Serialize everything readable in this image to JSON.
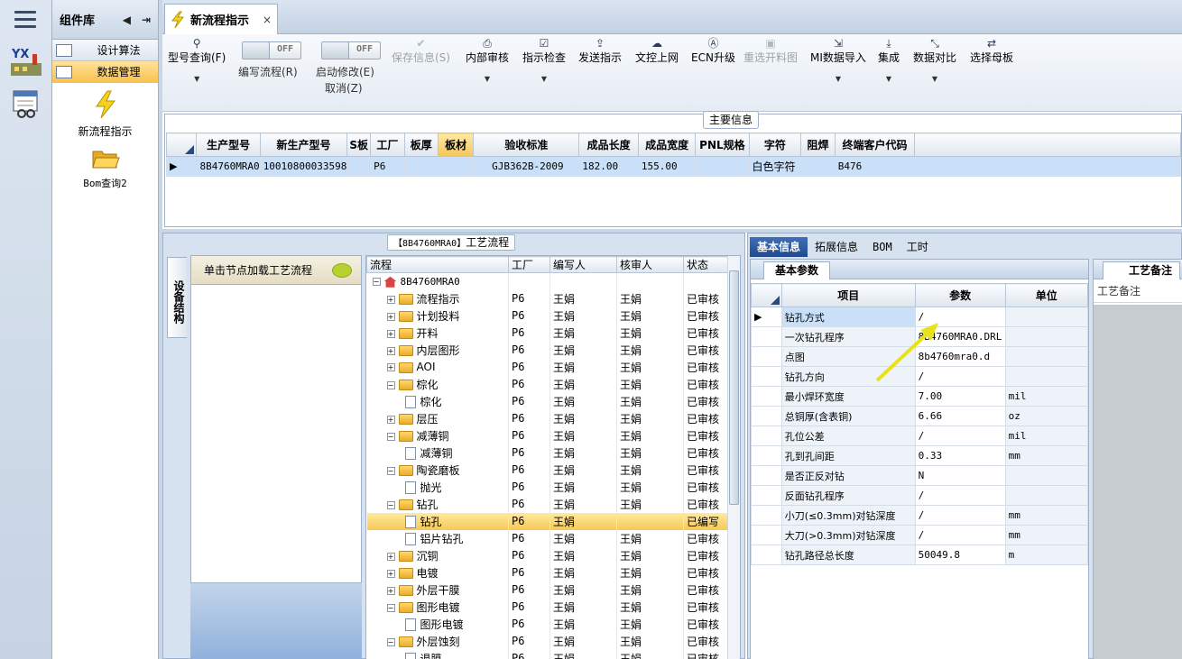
{
  "rail": {
    "logo_text": "YX"
  },
  "library": {
    "title": "组件库",
    "items": [
      {
        "label": "设计算法",
        "active": false
      },
      {
        "label": "数据管理",
        "active": true
      }
    ],
    "big": [
      {
        "label": "新流程指示"
      },
      {
        "label": "Bom查询2"
      }
    ]
  },
  "tab": {
    "title": "新流程指示",
    "close": "×"
  },
  "toolbar": {
    "model_query": "型号查询(F)",
    "edit_flow": "编写流程(R)",
    "edit_flow_toggle": "OFF",
    "start_modify": "启动修改(E)",
    "cancel": "取消(Z)",
    "start_modify_toggle": "OFF",
    "save_info": "保存信息(S)",
    "internal_review": "内部审核",
    "instruction_check": "指示检查",
    "send_instruction": "发送指示",
    "doc_control_online": "文控上网",
    "ecn_upgrade": "ECN升级",
    "reselect_panel_map": "重选开料图",
    "mi_data_import": "MI数据导入",
    "integrate": "集成",
    "data_compare": "数据对比",
    "select_mother_board": "选择母板"
  },
  "main_info": {
    "caption": "主要信息",
    "columns": [
      "生产型号",
      "新生产型号",
      "S板",
      "工厂",
      "板厚",
      "板材",
      "验收标准",
      "成品长度",
      "成品宽度",
      "PNL规格",
      "字符",
      "阻焊",
      "终端客户代码"
    ],
    "rows": [
      [
        "8B4760MRA0",
        "10010800033598",
        "",
        "P6",
        "",
        "",
        "GJB362B-2009",
        "182.00",
        "155.00",
        "",
        "白色字符",
        "",
        "B476"
      ]
    ]
  },
  "process": {
    "caption_code": "【8B4760MRA0】",
    "caption_text": "工艺流程",
    "side_tab": "设备结构",
    "hint": "单击节点加载工艺流程",
    "columns": [
      "流程",
      "工厂",
      "编写人",
      "核审人",
      "状态"
    ],
    "root": "8B4760MRA0",
    "rows": [
      {
        "name": "流程指示",
        "type": "folder",
        "expand": "+",
        "level": 1,
        "factory": "P6",
        "writer": "王娟",
        "reviewer": "王娟",
        "status": "已审核"
      },
      {
        "name": "计划投料",
        "type": "folder",
        "expand": "+",
        "level": 1,
        "factory": "P6",
        "writer": "王娟",
        "reviewer": "王娟",
        "status": "已审核"
      },
      {
        "name": "开料",
        "type": "folder",
        "expand": "+",
        "level": 1,
        "factory": "P6",
        "writer": "王娟",
        "reviewer": "王娟",
        "status": "已审核"
      },
      {
        "name": "内层图形",
        "type": "folder",
        "expand": "+",
        "level": 1,
        "factory": "P6",
        "writer": "王娟",
        "reviewer": "王娟",
        "status": "已审核"
      },
      {
        "name": "AOI",
        "type": "folder",
        "expand": "+",
        "level": 1,
        "factory": "P6",
        "writer": "王娟",
        "reviewer": "王娟",
        "status": "已审核"
      },
      {
        "name": "棕化",
        "type": "folder",
        "expand": "-",
        "level": 1,
        "factory": "P6",
        "writer": "王娟",
        "reviewer": "王娟",
        "status": "已审核"
      },
      {
        "name": "棕化",
        "type": "doc",
        "expand": "",
        "level": 2,
        "factory": "P6",
        "writer": "王娟",
        "reviewer": "王娟",
        "status": "已审核"
      },
      {
        "name": "层压",
        "type": "folder",
        "expand": "+",
        "level": 1,
        "factory": "P6",
        "writer": "王娟",
        "reviewer": "王娟",
        "status": "已审核"
      },
      {
        "name": "减薄铜",
        "type": "folder",
        "expand": "-",
        "level": 1,
        "factory": "P6",
        "writer": "王娟",
        "reviewer": "王娟",
        "status": "已审核"
      },
      {
        "name": "减薄铜",
        "type": "doc",
        "expand": "",
        "level": 2,
        "factory": "P6",
        "writer": "王娟",
        "reviewer": "王娟",
        "status": "已审核"
      },
      {
        "name": "陶瓷磨板",
        "type": "folder",
        "expand": "-",
        "level": 1,
        "factory": "P6",
        "writer": "王娟",
        "reviewer": "王娟",
        "status": "已审核"
      },
      {
        "name": "抛光",
        "type": "doc",
        "expand": "",
        "level": 2,
        "factory": "P6",
        "writer": "王娟",
        "reviewer": "王娟",
        "status": "已审核"
      },
      {
        "name": "钻孔",
        "type": "folder",
        "expand": "-",
        "level": 1,
        "factory": "P6",
        "writer": "王娟",
        "reviewer": "王娟",
        "status": "已审核"
      },
      {
        "name": "钻孔",
        "type": "doc",
        "expand": "",
        "level": 2,
        "factory": "P6",
        "writer": "王娟",
        "reviewer": "",
        "status": "已编写",
        "current": true
      },
      {
        "name": "铝片钻孔",
        "type": "doc",
        "expand": "",
        "level": 2,
        "factory": "P6",
        "writer": "王娟",
        "reviewer": "王娟",
        "status": "已审核"
      },
      {
        "name": "沉铜",
        "type": "folder",
        "expand": "+",
        "level": 1,
        "factory": "P6",
        "writer": "王娟",
        "reviewer": "王娟",
        "status": "已审核"
      },
      {
        "name": "电镀",
        "type": "folder",
        "expand": "+",
        "level": 1,
        "factory": "P6",
        "writer": "王娟",
        "reviewer": "王娟",
        "status": "已审核"
      },
      {
        "name": "外层干膜",
        "type": "folder",
        "expand": "+",
        "level": 1,
        "factory": "P6",
        "writer": "王娟",
        "reviewer": "王娟",
        "status": "已审核"
      },
      {
        "name": "图形电镀",
        "type": "folder",
        "expand": "-",
        "level": 1,
        "factory": "P6",
        "writer": "王娟",
        "reviewer": "王娟",
        "status": "已审核"
      },
      {
        "name": "图形电镀",
        "type": "doc",
        "expand": "",
        "level": 2,
        "factory": "P6",
        "writer": "王娟",
        "reviewer": "王娟",
        "status": "已审核"
      },
      {
        "name": "外层蚀刻",
        "type": "folder",
        "expand": "-",
        "level": 1,
        "factory": "P6",
        "writer": "王娟",
        "reviewer": "王娟",
        "status": "已审核"
      },
      {
        "name": "退膜",
        "type": "doc",
        "expand": "",
        "level": 2,
        "factory": "P6",
        "writer": "王娟",
        "reviewer": "王娟",
        "status": "已审核"
      }
    ]
  },
  "details": {
    "tabs": [
      {
        "label": "基本信息",
        "active": true
      },
      {
        "label": "拓展信息",
        "active": false
      },
      {
        "label": "BOM",
        "active": false
      },
      {
        "label": "工时",
        "active": false
      }
    ],
    "sub_tab": "基本参数",
    "columns": [
      "项目",
      "参数",
      "单位"
    ],
    "rows": [
      [
        "钻孔方式",
        "/",
        ""
      ],
      [
        "一次钻孔程序",
        "8B4760MRA0.DRL",
        ""
      ],
      [
        "点图",
        "8b4760mra0.d",
        ""
      ],
      [
        "钻孔方向",
        "/",
        ""
      ],
      [
        "最小焊环宽度",
        "7.00",
        "mil"
      ],
      [
        "总铜厚(含表铜)",
        "6.66",
        "oz"
      ],
      [
        "孔位公差",
        "/",
        "mil"
      ],
      [
        "孔到孔间距",
        "0.33",
        "mm"
      ],
      [
        "是否正反对钻",
        "N",
        ""
      ],
      [
        "反面钻孔程序",
        "/",
        ""
      ],
      [
        "小刀(≤0.3mm)对钻深度",
        "/",
        "mm"
      ],
      [
        "大刀(>0.3mm)对钻深度",
        "/",
        "mm"
      ],
      [
        "钻孔路径总长度",
        "50049.8",
        "m"
      ]
    ],
    "remarks_tab": "工艺备注",
    "remarks_label": "工艺备注"
  },
  "colors": {
    "accent": "#204a8c",
    "selection": "#c9e0f8",
    "current_row": "#f7c955",
    "arrow": "#e8e21a"
  }
}
